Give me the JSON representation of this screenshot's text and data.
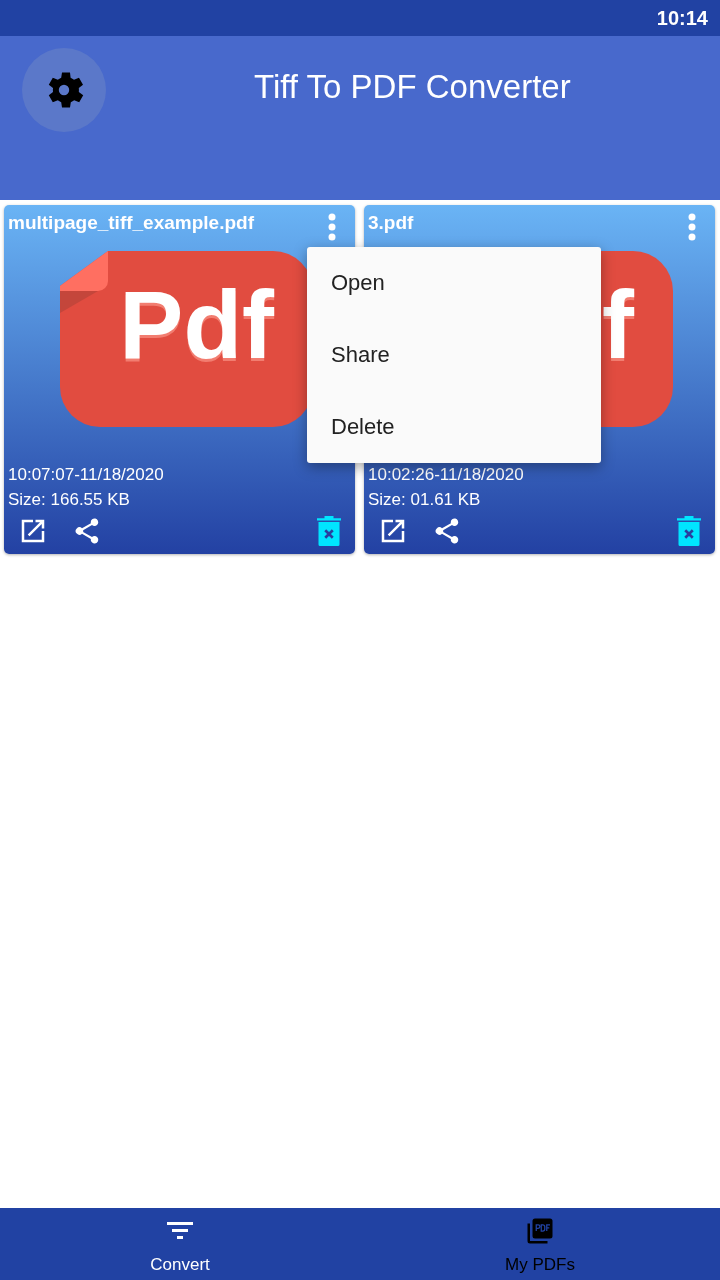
{
  "status_bar": {
    "time": "10:14"
  },
  "app_bar": {
    "title": "Tiff To PDF Converter"
  },
  "files": [
    {
      "name": "multipage_tiff_example.pdf",
      "thumbnail_text": "Pdf",
      "date": "10:07:07-11/18/2020",
      "size": "Size: 166.55 KB"
    },
    {
      "name": "3.pdf",
      "thumbnail_text": "f",
      "date": "10:02:26-11/18/2020",
      "size": "Size: 01.61 KB"
    }
  ],
  "menu": {
    "items": [
      "Open",
      "Share",
      "Delete"
    ]
  },
  "bottom_nav": [
    {
      "label": "Convert",
      "kind": "filter",
      "selected": false
    },
    {
      "label": "My PDFs",
      "kind": "pdf",
      "selected": true
    }
  ]
}
